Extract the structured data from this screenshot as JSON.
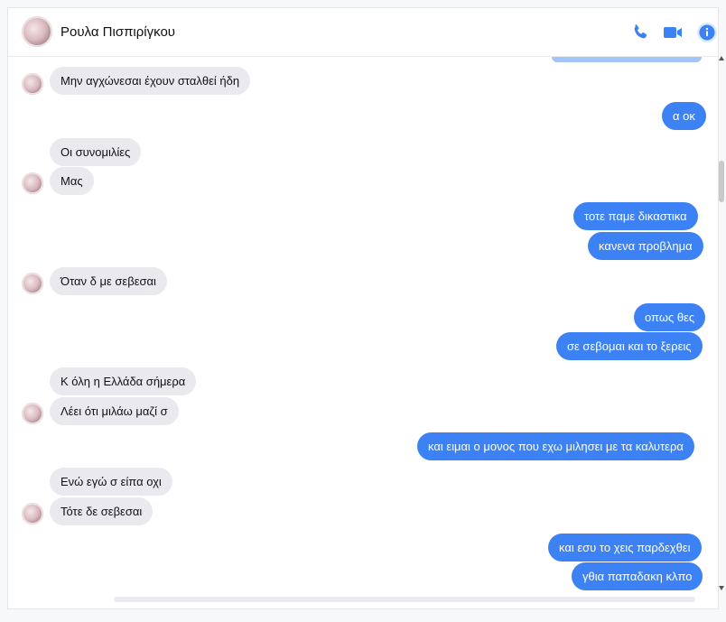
{
  "header": {
    "contact_name": "Ρουλα Πισπιρίγκου",
    "actions": [
      {
        "icon": "phone-icon"
      },
      {
        "icon": "video-camera-icon"
      },
      {
        "icon": "info-icon"
      }
    ]
  },
  "colors": {
    "accent": "#3c82f5",
    "incoming_bubble": "#e9e9ef",
    "outgoing_bubble": "#3c82f5"
  },
  "messages": [
    {
      "dir": "in",
      "text": "Μην αγχώνεσαι έχουν σταλθεί ήδη",
      "avatar": true
    },
    {
      "dir": "out",
      "text": "α οκ"
    },
    {
      "dir": "in",
      "text": "Οι συνομιλίες",
      "avatar": false
    },
    {
      "dir": "in",
      "text": "Μας",
      "avatar": true
    },
    {
      "dir": "out",
      "text": "τοτε παμε δικαστικα"
    },
    {
      "dir": "out",
      "text": "κανενα προβλημα"
    },
    {
      "dir": "in",
      "text": "Όταν δ με σεβεσαι",
      "avatar": true
    },
    {
      "dir": "out",
      "text": "οπως θες"
    },
    {
      "dir": "out",
      "text": "σε σεβομαι και το ξερεις"
    },
    {
      "dir": "in",
      "text": "Κ όλη η Ελλάδα σήμερα",
      "avatar": false
    },
    {
      "dir": "in",
      "text": "Λέει ότι μιλάω μαζί σ",
      "avatar": true
    },
    {
      "dir": "out",
      "text": "και ειμαι ο μονος που εχω μιλησει με τα καλυτερα"
    },
    {
      "dir": "in",
      "text": "Ενώ εγώ σ είπα οχι",
      "avatar": false
    },
    {
      "dir": "in",
      "text": "Τότε δε σεβεσαι",
      "avatar": true
    },
    {
      "dir": "out",
      "text": "και εσυ το χεις παρδεχθει"
    },
    {
      "dir": "out",
      "text": "γθια παπαδακη κλπο"
    }
  ]
}
